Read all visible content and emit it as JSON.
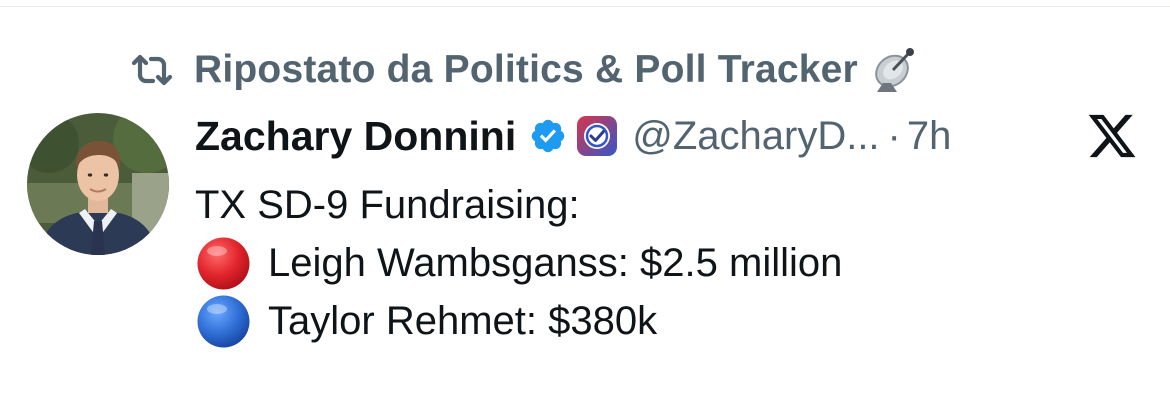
{
  "repost": {
    "icon": "repost-icon",
    "text": "Ripostato da Politics & Poll Tracker",
    "emoji": "satellite-antenna"
  },
  "author": {
    "avatar": "profile-photo",
    "name": "Zachary Donnini",
    "verified": "blue-checkmark",
    "affiliate_badge": "affiliate-check-badge",
    "handle": "@ZacharyD...",
    "separator": "·",
    "time": "7h"
  },
  "brand_icon": "x-logo",
  "tweet": {
    "lines": [
      {
        "marker": "",
        "text": "TX SD-9 Fundraising:"
      },
      {
        "marker": "red-circle",
        "text": "Leigh Wambsganss: $2.5 million"
      },
      {
        "marker": "blue-circle",
        "text": "Taylor Rehmet: $380k"
      }
    ]
  },
  "colors": {
    "secondary_text": "#536471",
    "primary_text": "#0f1419",
    "verified_blue": "#1d9bf0",
    "red_marker": "#d9262c",
    "blue_marker": "#2f6fd6"
  }
}
